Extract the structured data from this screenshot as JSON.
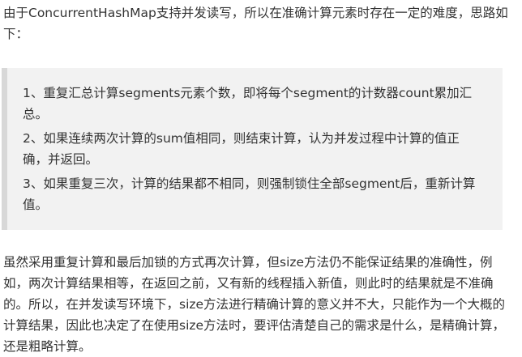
{
  "intro": "由于ConcurrentHashMap支持并发读写，所以在准确计算元素时存在一定的难度，思路如下：",
  "steps": [
    "1、重复汇总计算segments元素个数，即将每个segment的计数器count累加汇总。",
    "2、如果连续两次计算的sum值相同，则结束计算，认为并发过程中计算的值正确，并返回。",
    "3、如果重复三次，计算的结果都不相同，则强制锁住全部segment后，重新计算值。"
  ],
  "outro": "虽然采用重复计算和最后加锁的方式再次计算，但size方法仍不能保证结果的准确性，例如，两次计算结果相等，在返回之前，又有新的线程插入新值，则此时的结果就是不准确的。所以，在并发读写环境下，size方法进行精确计算的意义并不大，只能作为一个大概的计算结果，因此也决定了在使用size方法时，要评估清楚自己的需求是什么，是精确计算，还是粗略计算。"
}
